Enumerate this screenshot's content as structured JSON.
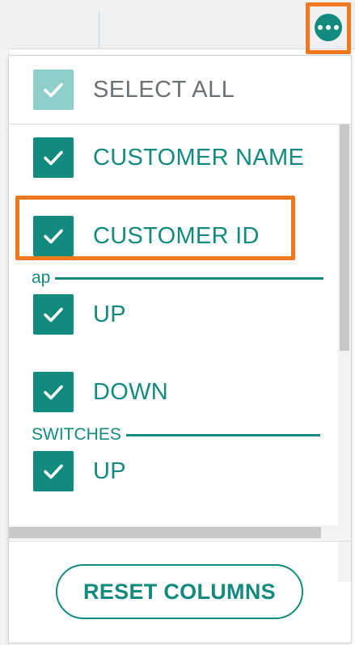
{
  "colors": {
    "accent": "#128a7d",
    "accent_light": "#8fcfc9",
    "highlight": "#f0791e",
    "muted_text": "#6c7175"
  },
  "more_button": {
    "icon": "more-horizontal-icon"
  },
  "column_chooser": {
    "select_all": {
      "label": "SELECT ALL",
      "checked": true
    },
    "items": [
      {
        "label": "CUSTOMER NAME",
        "checked": true
      },
      {
        "label": "CUSTOMER ID",
        "checked": true
      },
      {
        "label": "UP",
        "checked": true,
        "group": "ap"
      },
      {
        "label": "DOWN",
        "checked": true,
        "group": "ap"
      },
      {
        "label": "UP",
        "checked": true,
        "group": "SWITCHES"
      }
    ],
    "groups": [
      {
        "label": "ap"
      },
      {
        "label": "SWITCHES"
      }
    ],
    "reset_label": "RESET COLUMNS"
  }
}
